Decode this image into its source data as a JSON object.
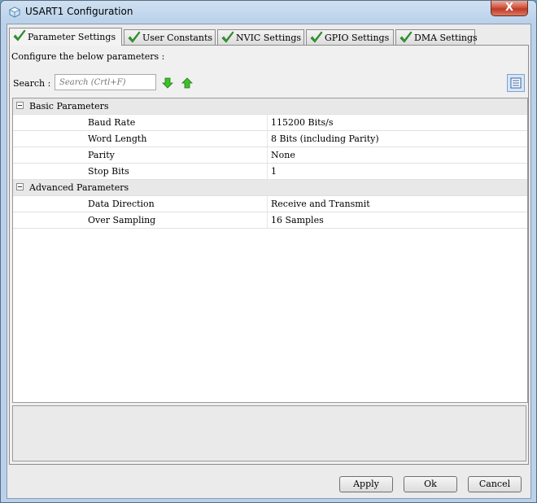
{
  "window": {
    "title": "USART1 Configuration",
    "close_label": "X"
  },
  "tabs": [
    {
      "label": "Parameter Settings"
    },
    {
      "label": "User Constants"
    },
    {
      "label": "NVIC Settings"
    },
    {
      "label": "GPIO Settings"
    },
    {
      "label": "DMA Settings"
    }
  ],
  "panel": {
    "configure_label": "Configure the below parameters :",
    "search_label": "Search :",
    "search_placeholder": "Search (Crtl+F)",
    "search_value": ""
  },
  "groups": [
    {
      "label": "Basic Parameters",
      "rows": [
        {
          "name": "Baud Rate",
          "value": "115200 Bits/s"
        },
        {
          "name": "Word Length",
          "value": "8 Bits (including Parity)"
        },
        {
          "name": "Parity",
          "value": "None"
        },
        {
          "name": "Stop Bits",
          "value": "1"
        }
      ]
    },
    {
      "label": "Advanced Parameters",
      "rows": [
        {
          "name": "Data Direction",
          "value": "Receive and Transmit"
        },
        {
          "name": "Over Sampling",
          "value": "16 Samples"
        }
      ]
    }
  ],
  "buttons": {
    "apply": "Apply",
    "ok": "Ok",
    "cancel": "Cancel"
  },
  "colors": {
    "check": "#2e9e2e",
    "arrow": "#3fbf2a",
    "title_bar": "#b9d1ea",
    "close": "#c0382a"
  }
}
